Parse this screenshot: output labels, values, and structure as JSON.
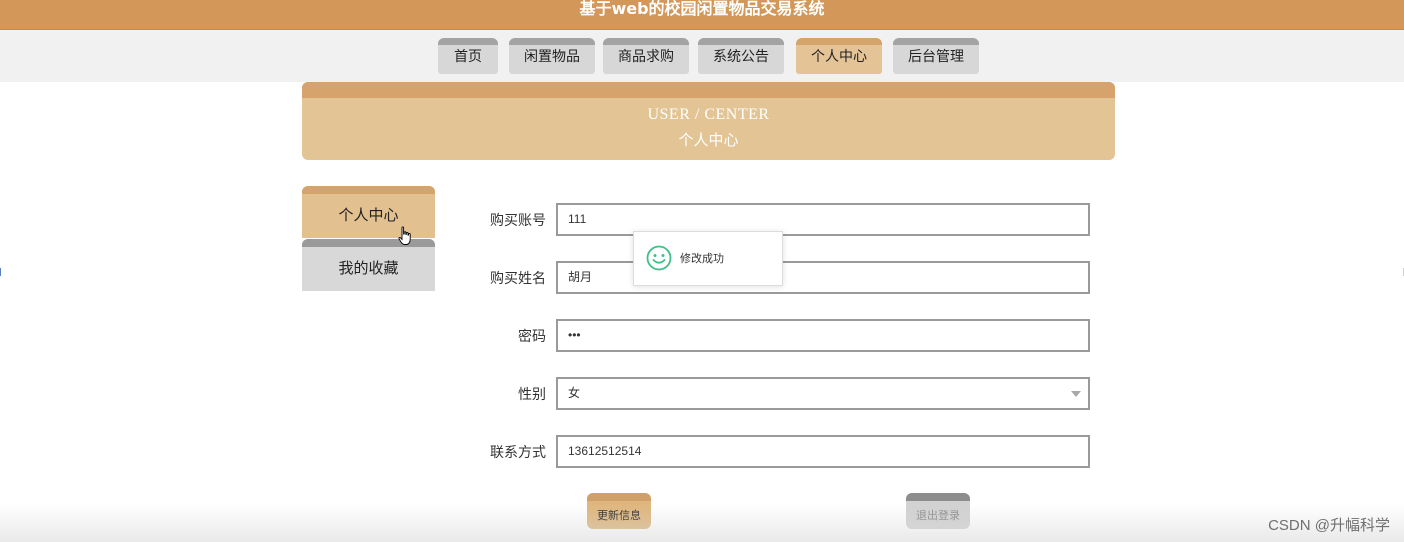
{
  "header": {
    "site_title": "基于web的校园闲置物品交易系统",
    "background_color": "#d29759"
  },
  "nav": {
    "tabs": [
      {
        "label": "首页",
        "active": false
      },
      {
        "label": "闲置物品",
        "active": false
      },
      {
        "label": "商品求购",
        "active": false
      },
      {
        "label": "系统公告",
        "active": false
      },
      {
        "label": "个人中心",
        "active": true
      },
      {
        "label": "后台管理",
        "active": false
      }
    ]
  },
  "banner": {
    "title_en": "USER / CENTER",
    "title_cn": "个人中心"
  },
  "sidebar": {
    "items": [
      {
        "label": "个人中心",
        "active": true
      },
      {
        "label": "我的收藏",
        "active": false
      }
    ]
  },
  "form": {
    "account": {
      "label": "购买账号",
      "value": "111"
    },
    "name": {
      "label": "购买姓名",
      "value": "胡月"
    },
    "password": {
      "label": "密码",
      "value": "•••"
    },
    "gender": {
      "label": "性别",
      "value": "女"
    },
    "phone": {
      "label": "联系方式",
      "value": "13612512514"
    }
  },
  "toast": {
    "message": "修改成功",
    "icon": "smiley-icon"
  },
  "buttons": {
    "update": "更新信息",
    "logout": "退出登录"
  },
  "watermark": "CSDN @升幅科学",
  "colors": {
    "accent": "#e3c495",
    "accent_dark": "#d4a46c",
    "inactive": "#d7d7d7",
    "success_icon": "#3fbf8a"
  }
}
